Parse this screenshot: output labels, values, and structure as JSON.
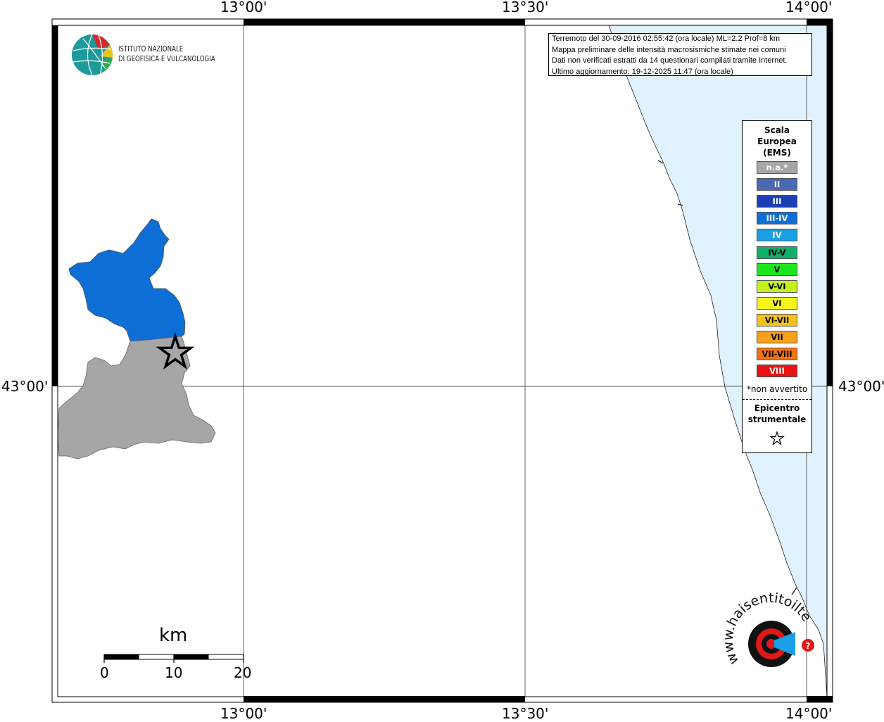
{
  "map": {
    "longitude_labels": [
      "13°00'",
      "13°30'",
      "14°00'"
    ],
    "latitude_labels": [
      "43°00'"
    ],
    "sea_color": "#e0f2fd"
  },
  "logo": {
    "line1": "ISTITUTO NAZIONALE",
    "line2": "DI GEOFISICA E VULCANOLOGIA"
  },
  "info_box": {
    "line1": "Terremoto del 30-09-2016 02:55:42 (ora locale) ML=2.2 Prof=8 km",
    "line2": "Mappa preliminare delle intensità macrosismiche stimate nei comuni",
    "line3": "Dati non verificati estratti da 14 questionari compilati tramite Internet.",
    "line4": "Ultimo aggiornamento: 19-12-2025 11:47 (ora locale)"
  },
  "legend": {
    "title_line1": "Scala",
    "title_line2": "Europea",
    "title_line3": "(EMS)",
    "classes": [
      {
        "label": "n.a.*",
        "color": "#a6a6a6",
        "text_dark": false
      },
      {
        "label": "II",
        "color": "#4a69b5",
        "text_dark": false
      },
      {
        "label": "III",
        "color": "#1d3fb4",
        "text_dark": false
      },
      {
        "label": "III-IV",
        "color": "#0d6fd6",
        "text_dark": false
      },
      {
        "label": "IV",
        "color": "#1a9ee6",
        "text_dark": false
      },
      {
        "label": "IV-V",
        "color": "#11b06a",
        "text_dark": true
      },
      {
        "label": "V",
        "color": "#1ee61e",
        "text_dark": true
      },
      {
        "label": "V-VI",
        "color": "#c4f01c",
        "text_dark": true
      },
      {
        "label": "VI",
        "color": "#f5f51d",
        "text_dark": true
      },
      {
        "label": "VI-VII",
        "color": "#f2c31a",
        "text_dark": true
      },
      {
        "label": "VII",
        "color": "#f7a01a",
        "text_dark": true
      },
      {
        "label": "VII-VIII",
        "color": "#f5720f",
        "text_dark": true
      },
      {
        "label": "VIII",
        "color": "#e81414",
        "text_dark": false
      }
    ],
    "note": "*non avvertito",
    "epicenter_line1": "Epicentro",
    "epicenter_line2": "strumentale"
  },
  "municipalities": [
    {
      "intensity": "III-IV",
      "color": "#0d6fd6"
    },
    {
      "intensity": "n.a.*",
      "color": "#a6a6a6"
    }
  ],
  "scale_bar": {
    "unit": "km",
    "ticks": [
      "0",
      "10",
      "20"
    ]
  },
  "watermark": {
    "text": "haisentitoilterremoto.it",
    "url_text": "www."
  }
}
